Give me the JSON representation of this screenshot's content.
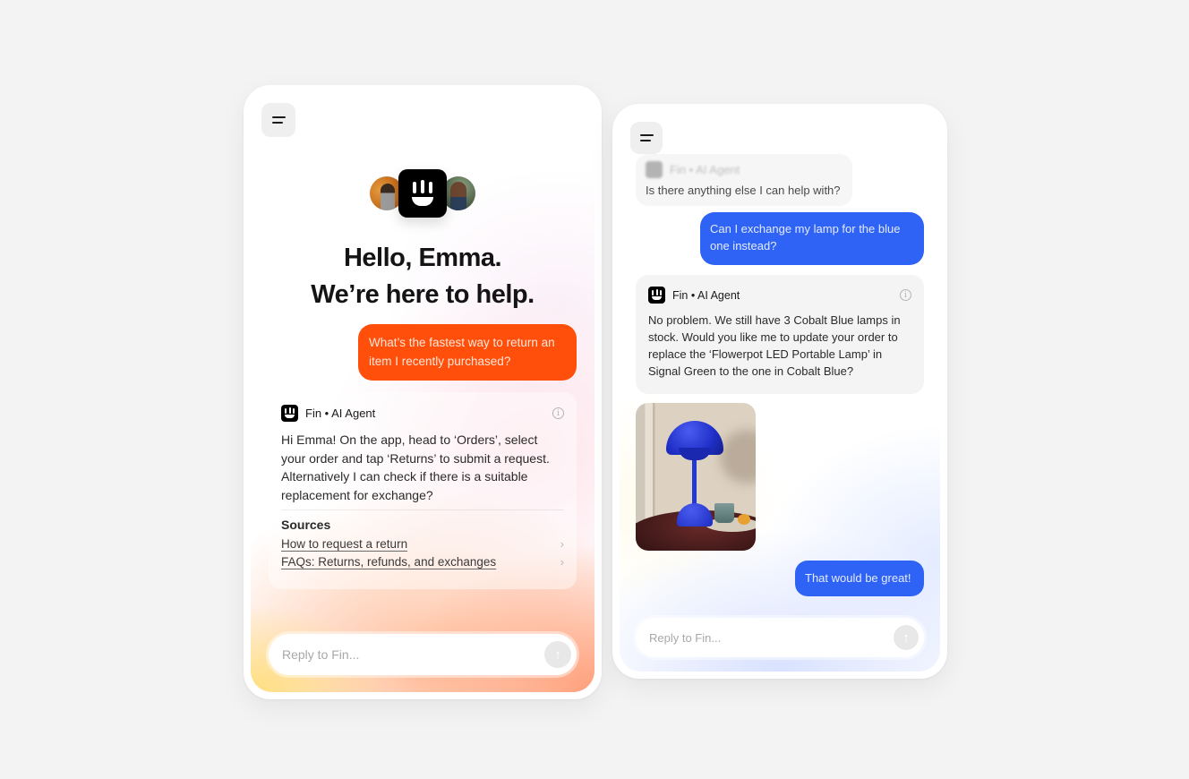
{
  "left_panel": {
    "menu_icon": "menu-icon",
    "greeting_line1": "Hello, Emma.",
    "greeting_line2": "We’re here to help.",
    "user_message": "What’s the fastest way to return an item I recently purchased?",
    "agent": {
      "name": "Fin • AI Agent",
      "info_icon": "i",
      "body": "Hi Emma! On the app, head to ‘Orders’, select your order and tap ‘Returns’ to submit a request. Alternatively I can check if there is a suitable replacement for exchange?",
      "sources_title": "Sources",
      "sources": [
        {
          "label": "How to request a return",
          "chevron": "›"
        },
        {
          "label": "FAQs: Returns, refunds, and exchanges",
          "chevron": "›"
        }
      ]
    },
    "composer": {
      "placeholder": "Reply to Fin...",
      "send_icon": "↑"
    }
  },
  "right_panel": {
    "menu_icon": "menu-icon",
    "prior_agent": {
      "name": "Fin • AI Agent",
      "body": "Is there anything else I can help with?"
    },
    "user_message_1": "Can I exchange my lamp for the blue one instead?",
    "agent": {
      "name": "Fin • AI Agent",
      "info_icon": "i",
      "body": "No problem. We still have 3 Cobalt Blue lamps in stock. Would you like me to update your order to replace the ‘Flowerpot LED Portable Lamp’ in Signal Green to the one in Cobalt Blue?"
    },
    "image_alt": "Cobalt Blue Flowerpot lamp photo",
    "user_message_2": "That would be great!",
    "composer": {
      "placeholder": "Reply to Fin...",
      "send_icon": "↑"
    }
  },
  "colors": {
    "user_bubble_orange": "#ff4f0a",
    "user_bubble_blue": "#2f63f5",
    "brand_black": "#000000"
  }
}
